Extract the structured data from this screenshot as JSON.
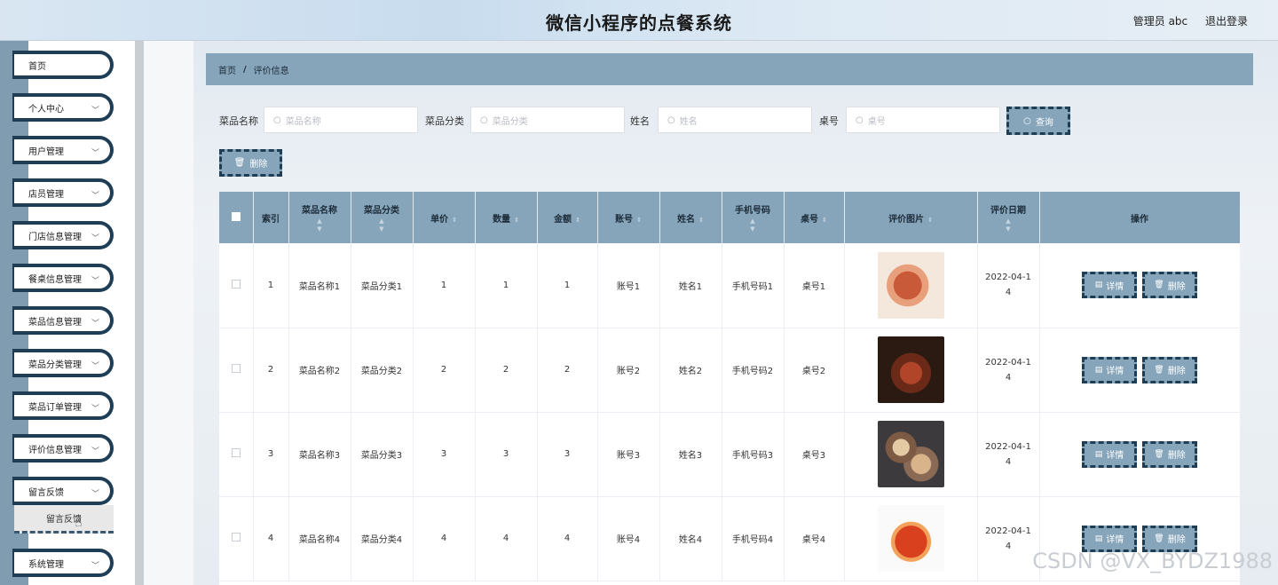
{
  "app": {
    "title": "微信小程序的点餐系统",
    "user_label": "管理员 abc",
    "logout_label": "退出登录"
  },
  "sidebar": {
    "items": [
      {
        "label": "首页",
        "has_chevron": false
      },
      {
        "label": "个人中心",
        "has_chevron": true
      },
      {
        "label": "用户管理",
        "has_chevron": true
      },
      {
        "label": "店员管理",
        "has_chevron": true
      },
      {
        "label": "门店信息管理",
        "has_chevron": true
      },
      {
        "label": "餐桌信息管理",
        "has_chevron": true
      },
      {
        "label": "菜品信息管理",
        "has_chevron": true
      },
      {
        "label": "菜品分类管理",
        "has_chevron": true
      },
      {
        "label": "菜品订单管理",
        "has_chevron": true
      },
      {
        "label": "评价信息管理",
        "has_chevron": true
      },
      {
        "label": "留言反馈",
        "has_chevron": true
      },
      {
        "label": "系统管理",
        "has_chevron": true
      }
    ],
    "submenu_label": "留言反馈",
    "chevron": "chevron-down-icon"
  },
  "breadcrumb": {
    "home": "首页",
    "separator": "/",
    "current": "评价信息"
  },
  "search": {
    "fields": [
      {
        "label": "菜品名称",
        "placeholder": "菜品名称"
      },
      {
        "label": "菜品分类",
        "placeholder": "菜品分类"
      },
      {
        "label": "姓名",
        "placeholder": "姓名"
      },
      {
        "label": "桌号",
        "placeholder": "桌号"
      }
    ],
    "query_label": "查询",
    "delete_label": "删除"
  },
  "table": {
    "headers": [
      "索引",
      "菜品名称",
      "菜品分类",
      "单价",
      "数量",
      "金额",
      "账号",
      "姓名",
      "手机号码",
      "桌号",
      "评价图片",
      "评价日期",
      "操作"
    ],
    "rows": [
      {
        "index": "1",
        "name": "菜品名称1",
        "category": "菜品分类1",
        "price": "1",
        "qty": "1",
        "amount": "1",
        "account": "账号1",
        "person": "姓名1",
        "phone": "手机号码1",
        "table_no": "桌号1",
        "date_a": "2022-04-1",
        "date_b": "4",
        "image": "food-photo-sliced-meat"
      },
      {
        "index": "2",
        "name": "菜品名称2",
        "category": "菜品分类2",
        "price": "2",
        "qty": "2",
        "amount": "2",
        "account": "账号2",
        "person": "姓名2",
        "phone": "手机号码2",
        "table_no": "桌号2",
        "date_a": "2022-04-1",
        "date_b": "4",
        "image": "food-photo-braised-pork"
      },
      {
        "index": "3",
        "name": "菜品名称3",
        "category": "菜品分类3",
        "price": "3",
        "qty": "3",
        "amount": "3",
        "account": "账号3",
        "person": "姓名3",
        "phone": "手机号码3",
        "table_no": "桌号3",
        "date_a": "2022-04-1",
        "date_b": "4",
        "image": "food-photo-plates"
      },
      {
        "index": "4",
        "name": "菜品名称4",
        "category": "菜品分类4",
        "price": "4",
        "qty": "4",
        "amount": "4",
        "account": "账号4",
        "person": "姓名4",
        "phone": "手机号码4",
        "table_no": "桌号4",
        "date_a": "2022-04-1",
        "date_b": "4",
        "image": "food-photo-crab"
      }
    ],
    "detail_label": "详情",
    "delete_label": "删除"
  },
  "watermark": "CSDN @VX_BYDZ1988",
  "colors": {
    "accent": "#86a5bb",
    "dark_border": "#1f3d55",
    "rail": "#7f9cb1"
  }
}
